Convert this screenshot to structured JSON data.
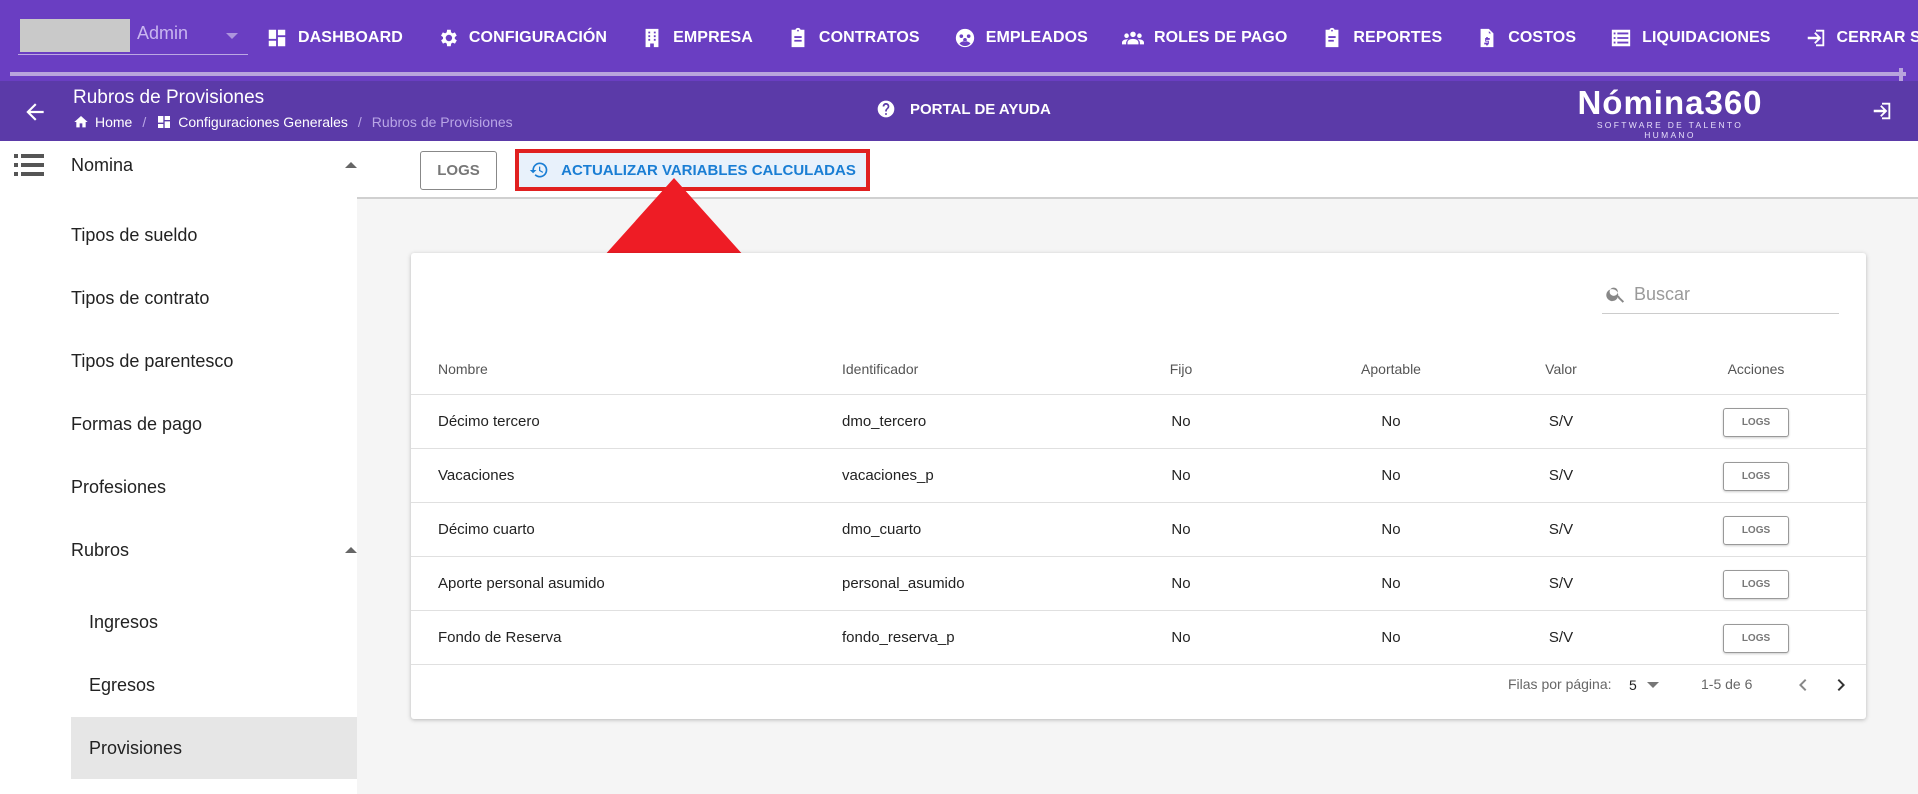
{
  "topnav": {
    "user_label": "Admin",
    "items": [
      {
        "label": "DASHBOARD",
        "icon": "dashboard-icon"
      },
      {
        "label": "CONFIGURACIÓN",
        "icon": "gear-icon"
      },
      {
        "label": "EMPRESA",
        "icon": "building-icon"
      },
      {
        "label": "CONTRATOS",
        "icon": "clipboard-icon"
      },
      {
        "label": "EMPLEADOS",
        "icon": "employees-icon"
      },
      {
        "label": "ROLES DE PAGO",
        "icon": "group-icon"
      },
      {
        "label": "REPORTES",
        "icon": "report-clipboard-icon"
      },
      {
        "label": "COSTOS",
        "icon": "invoice-icon"
      },
      {
        "label": "LIQUIDACIONES",
        "icon": "list-icon"
      },
      {
        "label": "CERRAR SESIÓN",
        "icon": "logout-icon"
      }
    ]
  },
  "header": {
    "title": "Rubros de Provisiones",
    "breadcrumb": {
      "home": "Home",
      "config": "Configuraciones Generales",
      "current": "Rubros de Provisiones"
    },
    "help_label": "PORTAL DE AYUDA",
    "logo_brand": "Nómina360",
    "logo_tagline": "SOFTWARE DE TALENTO HUMANO"
  },
  "sidebar": {
    "group_nomina": "Nomina",
    "items": [
      "Tipos de sueldo",
      "Tipos de contrato",
      "Tipos de parentesco",
      "Formas de pago",
      "Profesiones"
    ],
    "group_rubros": "Rubros",
    "sub_items": [
      "Ingresos",
      "Egresos",
      "Provisiones"
    ],
    "active": "Provisiones"
  },
  "toolbar": {
    "logs_label": "LOGS",
    "update_label": "ACTUALIZAR VARIABLES CALCULADAS"
  },
  "annotation": {
    "arrow_color": "#ee1c25",
    "highlight_color": "#e02020"
  },
  "table": {
    "search_placeholder": "Buscar",
    "columns": [
      "Nombre",
      "Identificador",
      "Fijo",
      "Aportable",
      "Valor",
      "Acciones"
    ],
    "rows": [
      {
        "nombre": "Décimo tercero",
        "identificador": "dmo_tercero",
        "fijo": "No",
        "aportable": "No",
        "valor": "S/V",
        "accion": "LOGS"
      },
      {
        "nombre": "Vacaciones",
        "identificador": "vacaciones_p",
        "fijo": "No",
        "aportable": "No",
        "valor": "S/V",
        "accion": "LOGS"
      },
      {
        "nombre": "Décimo cuarto",
        "identificador": "dmo_cuarto",
        "fijo": "No",
        "aportable": "No",
        "valor": "S/V",
        "accion": "LOGS"
      },
      {
        "nombre": "Aporte personal asumido",
        "identificador": "personal_asumido",
        "fijo": "No",
        "aportable": "No",
        "valor": "S/V",
        "accion": "LOGS"
      },
      {
        "nombre": "Fondo de Reserva",
        "identificador": "fondo_reserva_p",
        "fijo": "No",
        "aportable": "No",
        "valor": "S/V",
        "accion": "LOGS"
      }
    ],
    "pagination": {
      "rows_per_page_label": "Filas por página:",
      "rows_per_page": "5",
      "range": "1-5 de 6"
    }
  },
  "colors": {
    "primary": "#6a3ec2",
    "header": "#5b3aa8",
    "accent": "#1a7ed4"
  }
}
